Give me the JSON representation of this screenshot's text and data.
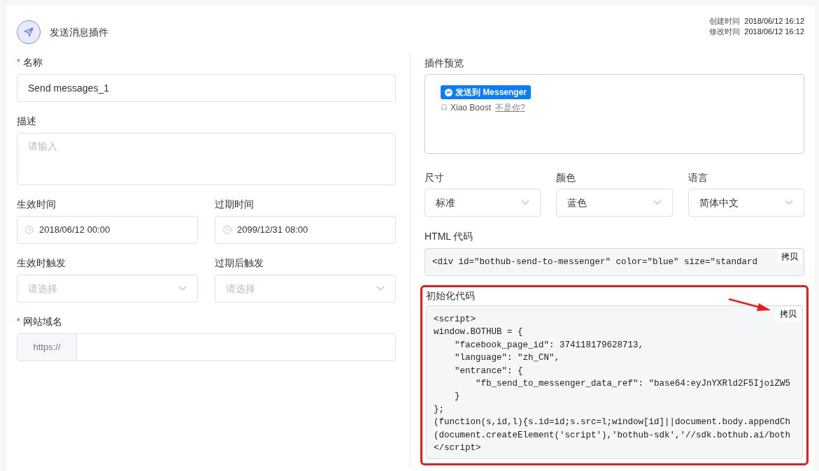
{
  "header": {
    "title": "发送消息插件",
    "meta": [
      {
        "label": "创建时间",
        "value": "2018/06/12 16:12"
      },
      {
        "label": "修改时间",
        "value": "2018/06/12 16:12"
      }
    ]
  },
  "left_form": [
    {
      "kind": "text",
      "label": "名称",
      "required_mark": "*",
      "value": "Send messages_1"
    },
    {
      "kind": "textarea",
      "label": "描述",
      "placeholder": "请输入"
    },
    {
      "kind": "pair",
      "fields": [
        {
          "kind": "date",
          "label": "生效时间",
          "value": "2018/06/12 00:00"
        },
        {
          "kind": "date",
          "label": "过期时间",
          "value": "2099/12/31 08:00"
        }
      ]
    },
    {
      "kind": "pair",
      "fields": [
        {
          "kind": "select",
          "label": "生效时触发",
          "placeholder": "请选择"
        },
        {
          "kind": "select",
          "label": "过期后触发",
          "placeholder": "请选择"
        }
      ]
    },
    {
      "kind": "prefixed",
      "label": "网站域名",
      "required_mark": "*",
      "prefix": "https://"
    }
  ],
  "preview": {
    "label": "插件预览",
    "button": "发送到 Messenger",
    "user": "Xiao Boost",
    "not_you": "不是你?"
  },
  "options": [
    {
      "label": "尺寸",
      "value": "标准"
    },
    {
      "label": "颜色",
      "value": "蓝色"
    },
    {
      "label": "语言",
      "value": "简体中文"
    }
  ],
  "html_code": {
    "label": "HTML 代码",
    "code": "<div id=\"bothub-send-to-messenger\" color=\"blue\" size=\"standard",
    "copy": "拷贝"
  },
  "init_code": {
    "label": "初始化代码",
    "highlighted": true,
    "copy": "拷贝",
    "lines": [
      "<script>",
      "window.BOTHUB = {",
      "    \"facebook_page_id\": 374118179628713,",
      "    \"language\": \"zh_CN\",",
      "    \"entrance\": {",
      "        \"fb_send_to_messenger_data_ref\": \"base64:eyJnYXRld2F5IjoiZW5",
      "    }",
      "};",
      "(function(s,id,l){s.id=id;s.src=l;window[id]||document.body.appendCh",
      "(document.createElement('script'),'bothub-sdk','//sdk.bothub.ai/both",
      "</script>"
    ]
  }
}
